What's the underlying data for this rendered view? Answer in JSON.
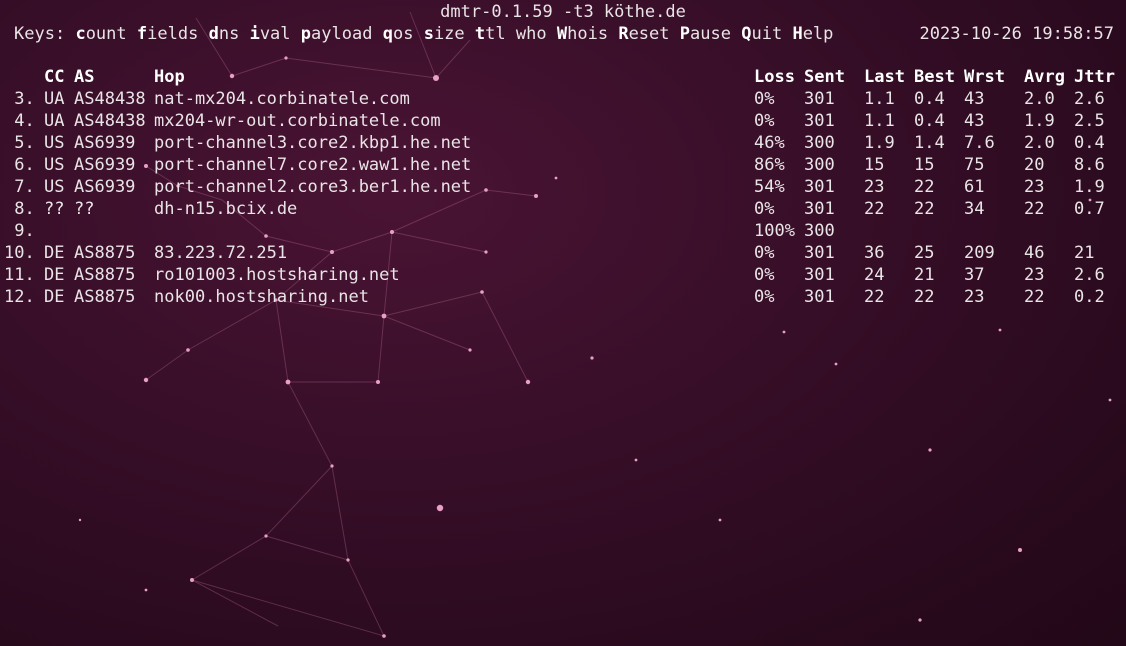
{
  "title": "dmtr-0.1.59 -t3 köthe.de",
  "datetime": "2023-10-26 19:58:57",
  "keys": {
    "prefix": "Keys:",
    "items": [
      {
        "key": "c",
        "rest": "ount"
      },
      {
        "key": "f",
        "rest": "ields"
      },
      {
        "key": "d",
        "rest": "ns"
      },
      {
        "key": "i",
        "rest": "val"
      },
      {
        "key": "p",
        "rest": "ayload"
      },
      {
        "key": "q",
        "rest": "os"
      },
      {
        "key": "s",
        "rest": "ize"
      },
      {
        "key": "t",
        "rest": "tl"
      },
      {
        "key": "",
        "rest": "who"
      },
      {
        "key": "W",
        "rest": "hois"
      },
      {
        "key": "R",
        "rest": "eset"
      },
      {
        "key": "P",
        "rest": "ause"
      },
      {
        "key": "Q",
        "rest": "uit"
      },
      {
        "key": "H",
        "rest": "elp"
      }
    ]
  },
  "columns": {
    "cc": "CC",
    "as": "AS",
    "hop": "Hop",
    "loss": "Loss",
    "sent": "Sent",
    "last": "Last",
    "best": "Best",
    "wrst": "Wrst",
    "avrg": "Avrg",
    "jttr": "Jttr"
  },
  "rows": [
    {
      "n": " 3.",
      "cc": "UA",
      "as": "AS48438",
      "hop": "nat-mx204.corbinatele.com",
      "loss": "0%",
      "sent": "301",
      "last": "1.1",
      "best": "0.4",
      "wrst": "43",
      "avrg": "2.0",
      "jttr": "2.6"
    },
    {
      "n": " 4.",
      "cc": "UA",
      "as": "AS48438",
      "hop": "mx204-wr-out.corbinatele.com",
      "loss": "0%",
      "sent": "301",
      "last": "1.1",
      "best": "0.4",
      "wrst": "43",
      "avrg": "1.9",
      "jttr": "2.5"
    },
    {
      "n": " 5.",
      "cc": "US",
      "as": "AS6939",
      "hop": "port-channel3.core2.kbp1.he.net",
      "loss": "46%",
      "sent": "300",
      "last": "1.9",
      "best": "1.4",
      "wrst": "7.6",
      "avrg": "2.0",
      "jttr": "0.4"
    },
    {
      "n": " 6.",
      "cc": "US",
      "as": "AS6939",
      "hop": "port-channel7.core2.waw1.he.net",
      "loss": "86%",
      "sent": "300",
      "last": "15",
      "best": "15",
      "wrst": "75",
      "avrg": "20",
      "jttr": "8.6"
    },
    {
      "n": " 7.",
      "cc": "US",
      "as": "AS6939",
      "hop": "port-channel2.core3.ber1.he.net",
      "loss": "54%",
      "sent": "301",
      "last": "23",
      "best": "22",
      "wrst": "61",
      "avrg": "23",
      "jttr": "1.9"
    },
    {
      "n": " 8.",
      "cc": "??",
      "as": "??",
      "hop": "dh-n15.bcix.de",
      "loss": "0%",
      "sent": "301",
      "last": "22",
      "best": "22",
      "wrst": "34",
      "avrg": "22",
      "jttr": "0.7"
    },
    {
      "n": " 9.",
      "cc": "",
      "as": "",
      "hop": "",
      "loss": "100%",
      "sent": "300",
      "last": "",
      "best": "",
      "wrst": "",
      "avrg": "",
      "jttr": ""
    },
    {
      "n": "10.",
      "cc": "DE",
      "as": "AS8875",
      "hop": "83.223.72.251",
      "loss": "0%",
      "sent": "301",
      "last": "36",
      "best": "25",
      "wrst": "209",
      "avrg": "46",
      "jttr": "21"
    },
    {
      "n": "11.",
      "cc": "DE",
      "as": "AS8875",
      "hop": "ro101003.hostsharing.net",
      "loss": "0%",
      "sent": "301",
      "last": "24",
      "best": "21",
      "wrst": "37",
      "avrg": "23",
      "jttr": "2.6"
    },
    {
      "n": "12.",
      "cc": "DE",
      "as": "AS8875",
      "hop": "nok00.hostsharing.net",
      "loss": "0%",
      "sent": "301",
      "last": "22",
      "best": "22",
      "wrst": "23",
      "avrg": "22",
      "jttr": "0.2"
    }
  ]
}
